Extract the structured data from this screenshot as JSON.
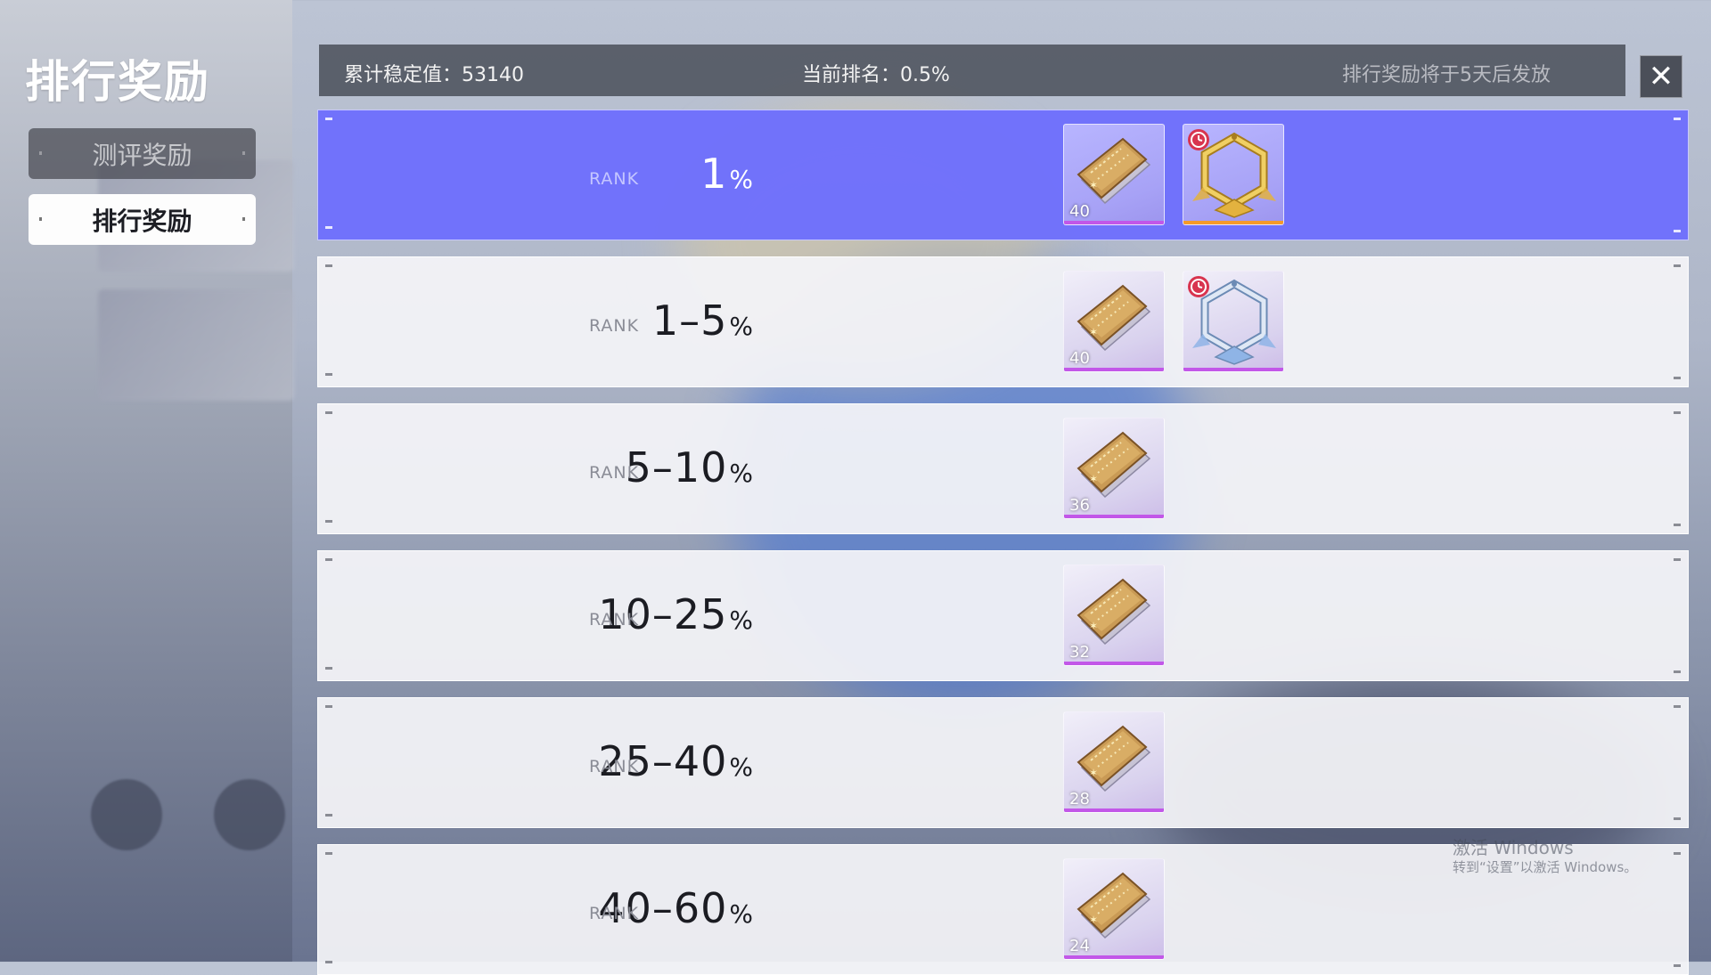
{
  "panel": {
    "title": "排行奖励",
    "tabs": [
      {
        "label": "测评奖励",
        "active": false
      },
      {
        "label": "排行奖励",
        "active": true
      }
    ]
  },
  "header": {
    "stability_label": "累计稳定值：53140",
    "current_rank_label": "当前排名：0.5%",
    "notice": "排行奖励将于5天后发放",
    "close_icon": "close-icon"
  },
  "rank_tag": "RANK",
  "rows": [
    {
      "range": "1",
      "pct": "%",
      "rewards": [
        {
          "type": "book",
          "qty": "40"
        },
        {
          "type": "gold-frame",
          "timed": true
        }
      ]
    },
    {
      "range": "1–5",
      "pct": "%",
      "rewards": [
        {
          "type": "book",
          "qty": "40"
        },
        {
          "type": "silver-frame",
          "timed": true
        }
      ]
    },
    {
      "range": "5–10",
      "pct": "%",
      "rewards": [
        {
          "type": "book",
          "qty": "36"
        }
      ]
    },
    {
      "range": "10–25",
      "pct": "%",
      "rewards": [
        {
          "type": "book",
          "qty": "32"
        }
      ]
    },
    {
      "range": "25–40",
      "pct": "%",
      "rewards": [
        {
          "type": "book",
          "qty": "28"
        }
      ]
    },
    {
      "range": "40–60",
      "pct": "%",
      "rewards": [
        {
          "type": "book",
          "qty": "24"
        }
      ]
    }
  ],
  "watermark": {
    "line1": "激活 Windows",
    "line2": "转到“设置”以激活 Windows。"
  },
  "colors": {
    "highlight_row": "#6e70fc",
    "rarity_purple": "#c257e8",
    "rarity_orange": "#f59a2a",
    "header_bar": "#464a54"
  }
}
